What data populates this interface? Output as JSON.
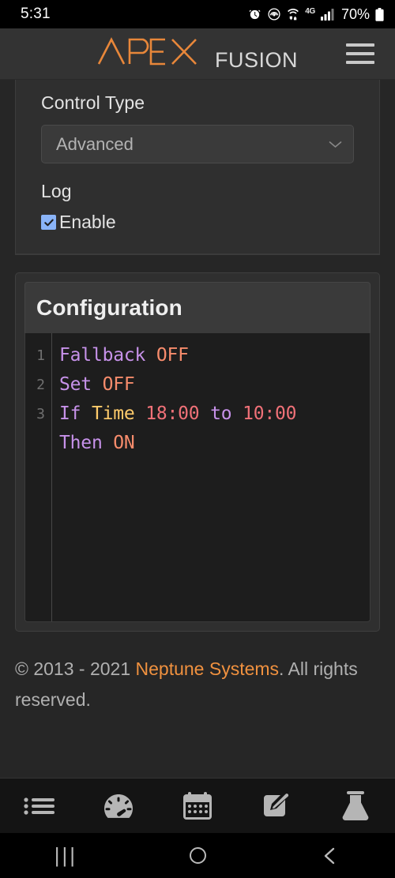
{
  "status_bar": {
    "time": "5:31",
    "battery_percent": "70%",
    "network_label": "4G",
    "icons": [
      "alarm-icon",
      "hotspot-icon",
      "wifi-transfer-icon",
      "network-4g-icon",
      "signal-bars-icon",
      "battery-icon"
    ]
  },
  "header": {
    "logo_primary": "APEX",
    "logo_secondary": "FUSION",
    "menu_label": "Menu"
  },
  "settings_panel": {
    "control_type_label": "Control Type",
    "control_type_value": "Advanced",
    "log_label": "Log",
    "enable_label": "Enable",
    "enable_checked": true
  },
  "configuration": {
    "title": "Configuration",
    "line_numbers": [
      "1",
      "2",
      "3"
    ],
    "code_lines": [
      [
        {
          "t": "Fallback",
          "c": "kw"
        },
        {
          "t": " ",
          "c": "plain"
        },
        {
          "t": "OFF",
          "c": "val"
        }
      ],
      [
        {
          "t": "Set",
          "c": "kw"
        },
        {
          "t": " ",
          "c": "plain"
        },
        {
          "t": "OFF",
          "c": "val"
        }
      ],
      [
        {
          "t": "If",
          "c": "kw"
        },
        {
          "t": " ",
          "c": "plain"
        },
        {
          "t": "Time",
          "c": "fn"
        },
        {
          "t": " ",
          "c": "plain"
        },
        {
          "t": "18:00",
          "c": "num"
        },
        {
          "t": " ",
          "c": "plain"
        },
        {
          "t": "to",
          "c": "kw"
        },
        {
          "t": " ",
          "c": "plain"
        },
        {
          "t": "10:00",
          "c": "num"
        }
      ],
      [
        {
          "t": "Then",
          "c": "kw"
        },
        {
          "t": " ",
          "c": "plain"
        },
        {
          "t": "ON",
          "c": "val"
        }
      ]
    ],
    "code_plain_text": "Fallback OFF\nSet OFF\nIf Time 18:00 to 10:00\nThen ON"
  },
  "footer": {
    "copyright_prefix": "© 2013 - 2021 ",
    "brand": "Neptune Systems",
    "copyright_suffix": ". All rights reserved."
  },
  "tabbar": {
    "items": [
      {
        "name": "tab-list",
        "icon": "list-icon"
      },
      {
        "name": "tab-dashboard",
        "icon": "gauge-icon"
      },
      {
        "name": "tab-calendar",
        "icon": "calendar-icon"
      },
      {
        "name": "tab-edit",
        "icon": "edit-square-icon"
      },
      {
        "name": "tab-lab",
        "icon": "flask-icon"
      }
    ]
  },
  "android_nav": {
    "recents": "|||",
    "home_icon": "home-circle-icon",
    "back_icon": "back-chevron-icon"
  },
  "colors": {
    "accent_orange": "#f0913f",
    "checkbox_blue": "#8ab4f8",
    "keyword_purple": "#c792ea",
    "value_orange": "#f78c6c",
    "function_yellow": "#ffcb6b",
    "number_pink": "#f07178",
    "app_background": "#262626",
    "card_background": "#2f2f2f",
    "editor_background": "#1d1d1d"
  }
}
